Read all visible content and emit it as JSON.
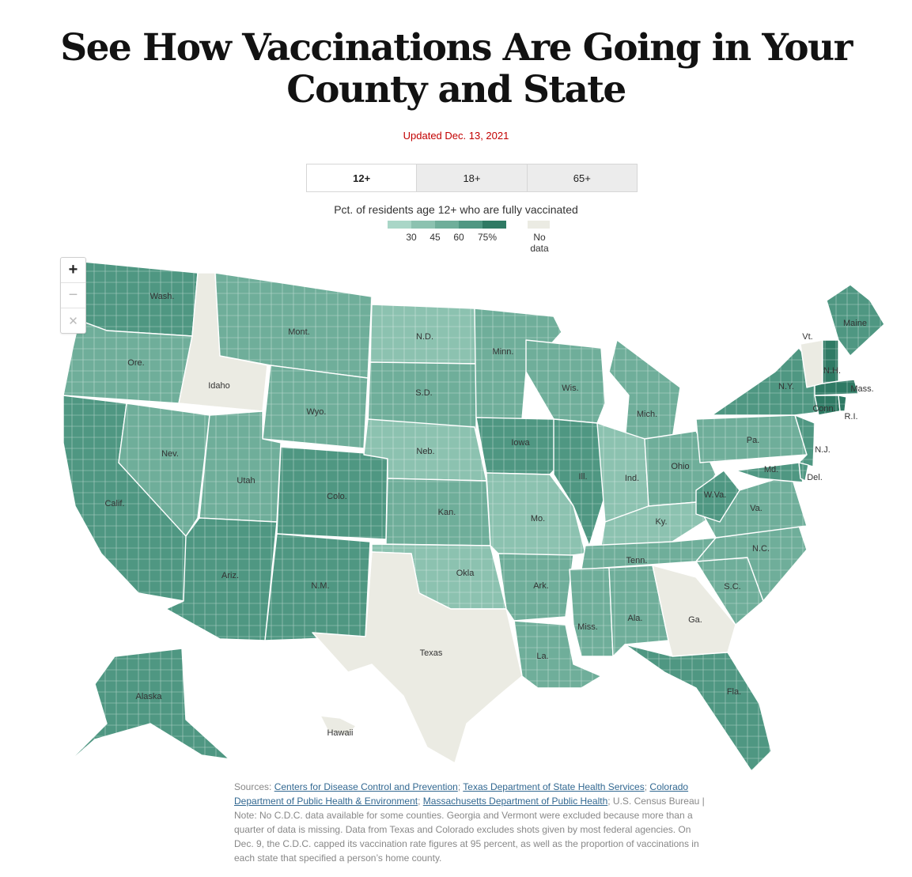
{
  "headline": "See How Vaccinations Are Going in Your County and State",
  "updated": "Updated Dec. 13, 2021",
  "tabs": [
    {
      "label": "12+",
      "active": true
    },
    {
      "label": "18+",
      "active": false
    },
    {
      "label": "65+",
      "active": false
    }
  ],
  "legend": {
    "title": "Pct. of residents age 12+ who are fully vaccinated",
    "ticks": [
      "30",
      "45",
      "60",
      "75%"
    ],
    "no_data": "No data",
    "colors": [
      "#a9d6c7",
      "#8cc2b0",
      "#6fae9a",
      "#4f9782",
      "#2f7a64"
    ],
    "no_data_color": "#ebebe3"
  },
  "zoom": {
    "in_icon": "plus-icon",
    "out_icon": "minus-icon",
    "reset_icon": "close-icon"
  },
  "state_labels": {
    "wa": "Wash.",
    "or": "Ore.",
    "ca": "Calif.",
    "nv": "Nev.",
    "id": "Idaho",
    "mt": "Mont.",
    "wy": "Wyo.",
    "ut": "Utah",
    "az": "Ariz.",
    "co": "Colo.",
    "nm": "N.M.",
    "nd": "N.D.",
    "sd": "S.D.",
    "ne": "Neb.",
    "ks": "Kan.",
    "ok": "Okla",
    "tx": "Texas",
    "mn": "Minn.",
    "ia": "Iowa",
    "mo": "Mo.",
    "ar": "Ark.",
    "la": "La.",
    "wi": "Wis.",
    "il": "Ill.",
    "mi": "Mich.",
    "in": "Ind.",
    "oh": "Ohio",
    "ky": "Ky.",
    "tn": "Tenn.",
    "ms": "Miss.",
    "al": "Ala.",
    "ga": "Ga.",
    "fl": "Fla.",
    "sc": "S.C.",
    "nc": "N.C.",
    "va": "Va.",
    "wv": "W.Va.",
    "md": "Md.",
    "de": "Del.",
    "nj": "N.J.",
    "pa": "Pa.",
    "ny": "N.Y.",
    "ct": "Conn.",
    "ri": "R.I.",
    "ma": "Mass.",
    "vt": "Vt.",
    "nh": "N.H.",
    "me": "Maine",
    "ak": "Alaska",
    "hi": "Hawaii"
  },
  "sources": {
    "prefix": "Sources: ",
    "links": [
      "Centers for Disease Control and Prevention",
      "Texas Department of State Health Services",
      "Colorado Department of Public Health & Environment",
      "Massachusetts Department of Public Health"
    ],
    "census": "U.S. Census Bureau",
    "note": " | Note: No C.D.C. data available for some counties. Georgia and Vermont were excluded because more than a quarter of data is missing. Data from Texas and Colorado excludes shots given by most federal agencies. On Dec. 9, the C.D.C. capped its vaccination rate figures at 95 percent, as well as the proportion of vaccinations in each state that specified a person’s home county."
  }
}
